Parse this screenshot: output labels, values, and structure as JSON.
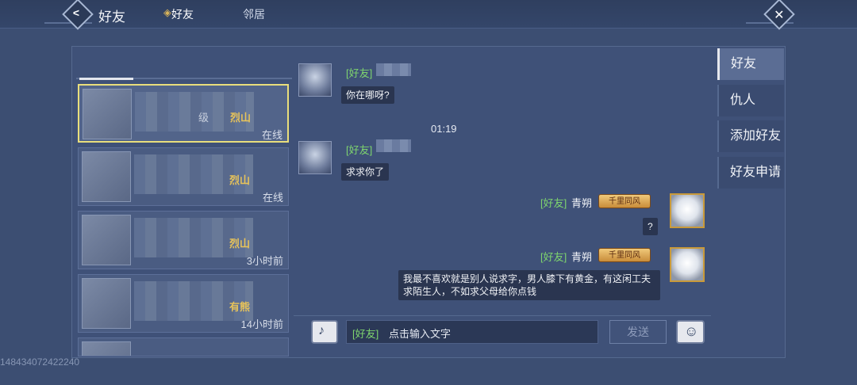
{
  "header": {
    "title": "好友",
    "back_icon": "back-chevron-icon",
    "close_icon": "close-icon"
  },
  "left_tabs": [
    {
      "label": "好友"
    },
    {
      "label": "邻居"
    }
  ],
  "friends": [
    {
      "level": "级",
      "sect": "烈山",
      "status": "在线",
      "selected": true
    },
    {
      "level": "",
      "sect": "烈山",
      "status": "在线",
      "selected": false
    },
    {
      "level": "",
      "sect": "烈山",
      "status": "3小时前",
      "selected": false
    },
    {
      "level": "",
      "sect": "有熊",
      "status": "14小时前",
      "selected": false
    }
  ],
  "uid": "148434072422240",
  "chat": {
    "messages": [
      {
        "tag": "[好友]",
        "name": "",
        "text": "你在哪呀?",
        "side": "left"
      },
      {
        "tag": "[好友]",
        "name": "",
        "text": "求求你了",
        "side": "left"
      },
      {
        "tag": "[好友]",
        "name": "青朔",
        "badge": "千里同风",
        "text": "?",
        "side": "right"
      },
      {
        "tag": "[好友]",
        "name": "青朔",
        "badge": "千里同风",
        "text": "我最不喜欢就是别人说求字，男人膝下有黄金，有这闲工夫求陌生人，不如求父母给你点钱",
        "side": "right"
      }
    ],
    "timestamp": "01:19"
  },
  "input": {
    "tag": "[好友]",
    "placeholder": "点击输入文字",
    "send_label": "发送"
  },
  "side_tabs": [
    {
      "label": "好友",
      "active": true
    },
    {
      "label": "仇人",
      "active": false
    },
    {
      "label": "添加好友",
      "active": false
    },
    {
      "label": "好友申请",
      "active": false
    }
  ],
  "colors": {
    "background": "#3c4e72",
    "selected_border": "#e9de7c",
    "friend_tag": "#7ed46e",
    "sect_gold": "#e7c35a"
  }
}
